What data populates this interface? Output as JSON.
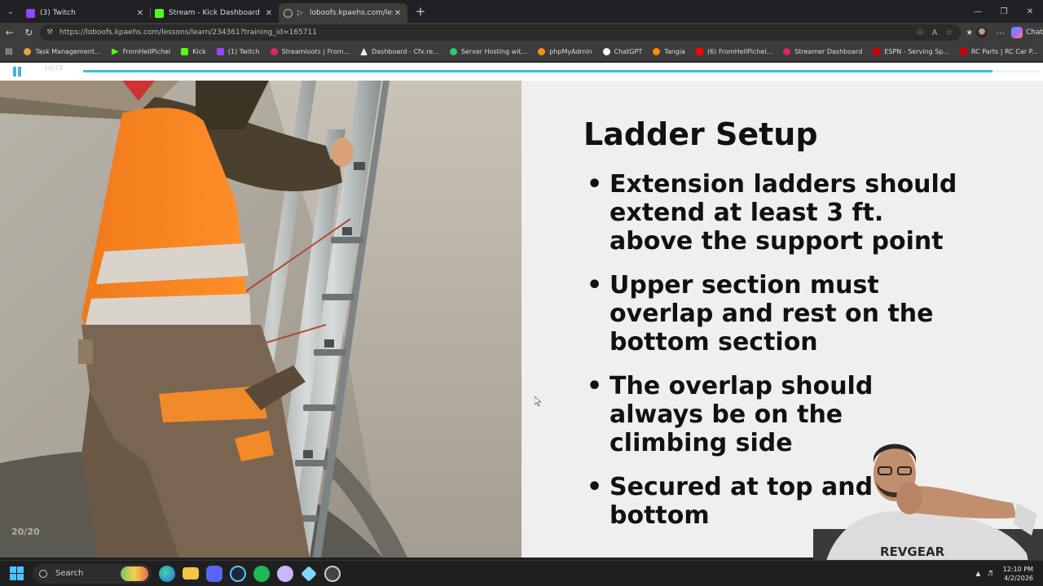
{
  "browser": {
    "tabs": [
      {
        "title": "(3) Twitch",
        "color": "#9146ff",
        "active": false
      },
      {
        "title": "Stream - Kick Dashboard",
        "color": "#53fc18",
        "active": false
      },
      {
        "title": "loboofs.kpaehs.com/lessons/l",
        "color": "#aaaaaa",
        "active": true
      }
    ],
    "url": "https://loboofs.kpaehs.com/lessons/learn/234361?training_id=165711",
    "chat_label": "Chat",
    "bookmarks": [
      {
        "label": "Task Management...",
        "color": "#e8a33d"
      },
      {
        "label": "FromHellPichel",
        "color": "#53fc18"
      },
      {
        "label": "Kick",
        "color": "#53fc18"
      },
      {
        "label": "(1) Twitch",
        "color": "#9146ff"
      },
      {
        "label": "Streamloots | From...",
        "color": "#e0245e"
      },
      {
        "label": "Dashboard - Cfx.re...",
        "color": "#f0f0f0"
      },
      {
        "label": "Server Hosting wit...",
        "color": "#2ecc71"
      },
      {
        "label": "phpMyAdmin",
        "color": "#f29111"
      },
      {
        "label": "ChatGPT",
        "color": "#ffffff"
      },
      {
        "label": "Tangia",
        "color": "#ff8a00"
      },
      {
        "label": "(6) FromHellPichel...",
        "color": "#ff0000"
      },
      {
        "label": "Streamer Dashboard",
        "color": "#e0245e"
      },
      {
        "label": "ESPN - Serving Sp...",
        "color": "#d00000"
      },
      {
        "label": "RC Parts | RC Car P...",
        "color": "#cc0000"
      }
    ]
  },
  "player": {
    "counter": "16/29",
    "progress": 0.95,
    "accent": "#40bfd9"
  },
  "slide": {
    "title": "Ladder Setup",
    "bullets": [
      "Extension ladders should extend at least 3 ft. above the support point",
      "Upper section must overlap and rest on the bottom section",
      "The overlap should always be on the climbing side",
      "Secured at top and bottom"
    ],
    "page_badge": "20/20"
  },
  "webcam": {
    "shirt_text": "REVGEAR"
  },
  "taskbar": {
    "search_label": "Search",
    "time": "12:10 PM",
    "date": "4/2/2026"
  }
}
